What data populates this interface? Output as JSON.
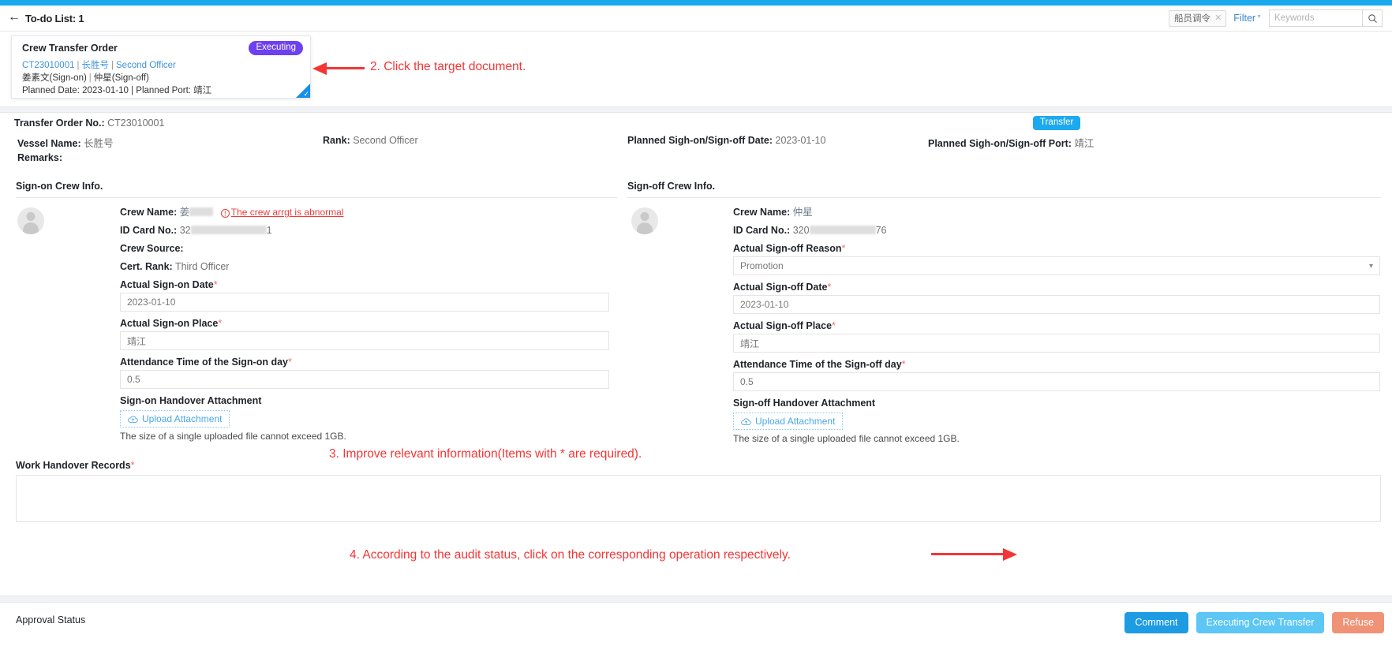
{
  "header": {
    "back_icon": "back-arrow-icon",
    "todo_title": "To-do List: 1",
    "tag_chip": "船员调令",
    "tag_close_icon": "✕",
    "filter_label": "Filter",
    "search_placeholder": "Keywords",
    "search_value": "",
    "search_icon": "search-icon"
  },
  "todo_card": {
    "title": "Crew Transfer Order",
    "status_badge": "Executing",
    "order_no": "CT23010001",
    "vessel": "长胜号",
    "rank": "Second Officer",
    "signon_person": "姜素文(Sign-on)",
    "signoff_person": "仲星(Sign-off)",
    "planned_line": "Planned Date: 2023-01-10 | Planned Port: 靖江",
    "corner_icon": "check-corner-icon"
  },
  "annotations": [
    {
      "id": "step2",
      "text": "2. Click the target document."
    },
    {
      "id": "step3",
      "text": "3. Improve relevant information(Items with * are required)."
    },
    {
      "id": "step4",
      "text": "4. According to the audit status, click on the corresponding operation respectively."
    }
  ],
  "detail": {
    "order_no_label": "Transfer Order No.:",
    "order_no_value": "CT23010001",
    "vessel_label": "Vessel Name:",
    "vessel_value": "长胜号",
    "rank_label": "Rank:",
    "rank_value": "Second Officer",
    "planned_date_label": "Planned Sigh-on/Sign-off Date:",
    "planned_date_value": "2023-01-10",
    "planned_port_label": "Planned Sigh-on/Sign-off Port:",
    "planned_port_value": "靖江",
    "remarks_label": "Remarks:",
    "remarks_value": "",
    "transfer_badge": "Transfer"
  },
  "signon": {
    "section_title": "Sign-on Crew Info.",
    "crew_name_label": "Crew Name:",
    "crew_name_value": "姜",
    "warning_text": "The crew arrgt is abnormal",
    "warning_icon": "warning-circle-icon",
    "id_card_label": "ID Card No.:",
    "id_card_prefix": "32",
    "id_card_suffix": "1",
    "crew_source_label": "Crew Source:",
    "crew_source_value": "",
    "cert_rank_label": "Cert. Rank:",
    "cert_rank_value": "Third Officer",
    "date_label": "Actual Sign-on Date",
    "date_value": "2023-01-10",
    "place_label": "Actual Sign-on Place",
    "place_value": "靖江",
    "attendance_label": "Attendance Time of the Sign-on day",
    "attendance_value": "0.5",
    "attachment_label": "Sign-on Handover Attachment",
    "upload_button": "Upload Attachment",
    "upload_icon": "cloud-upload-icon",
    "size_hint": "The size of a single uploaded file cannot exceed 1GB.",
    "avatar_icon": "user-avatar-icon"
  },
  "signoff": {
    "section_title": "Sign-off Crew Info.",
    "crew_name_label": "Crew Name:",
    "crew_name_value": "仲星",
    "id_card_label": "ID Card No.:",
    "id_card_prefix": "320",
    "id_card_suffix": "76",
    "reason_label": "Actual Sign-off Reason",
    "reason_value": "Promotion",
    "reason_caret_icon": "chevron-down-icon",
    "date_label": "Actual Sign-off Date",
    "date_value": "2023-01-10",
    "place_label": "Actual Sign-off Place",
    "place_value": "靖江",
    "attendance_label": "Attendance Time of the Sign-off day",
    "attendance_value": "0.5",
    "attachment_label": "Sign-off Handover Attachment",
    "upload_button": "Upload Attachment",
    "upload_icon": "cloud-upload-icon",
    "size_hint": "The size of a single uploaded file cannot exceed 1GB.",
    "avatar_icon": "user-avatar-icon"
  },
  "work_handover": {
    "label": "Work Handover Records",
    "value": ""
  },
  "footer": {
    "approval_status_label": "Approval Status",
    "comment_button": "Comment",
    "exec_button": "Executing Crew Transfer",
    "refuse_button": "Refuse"
  },
  "colors": {
    "top_strip": "#1AA9EC",
    "executing_badge": "#6D40F0",
    "transfer_badge": "#1DA9F0",
    "annotation_red": "#F43535",
    "comment_blue": "#1D9BE3",
    "exec_blue": "#5CC6F5",
    "refuse_orange": "#F09276",
    "required_star": "#F56C6C",
    "link_blue": "#3F93D8"
  }
}
